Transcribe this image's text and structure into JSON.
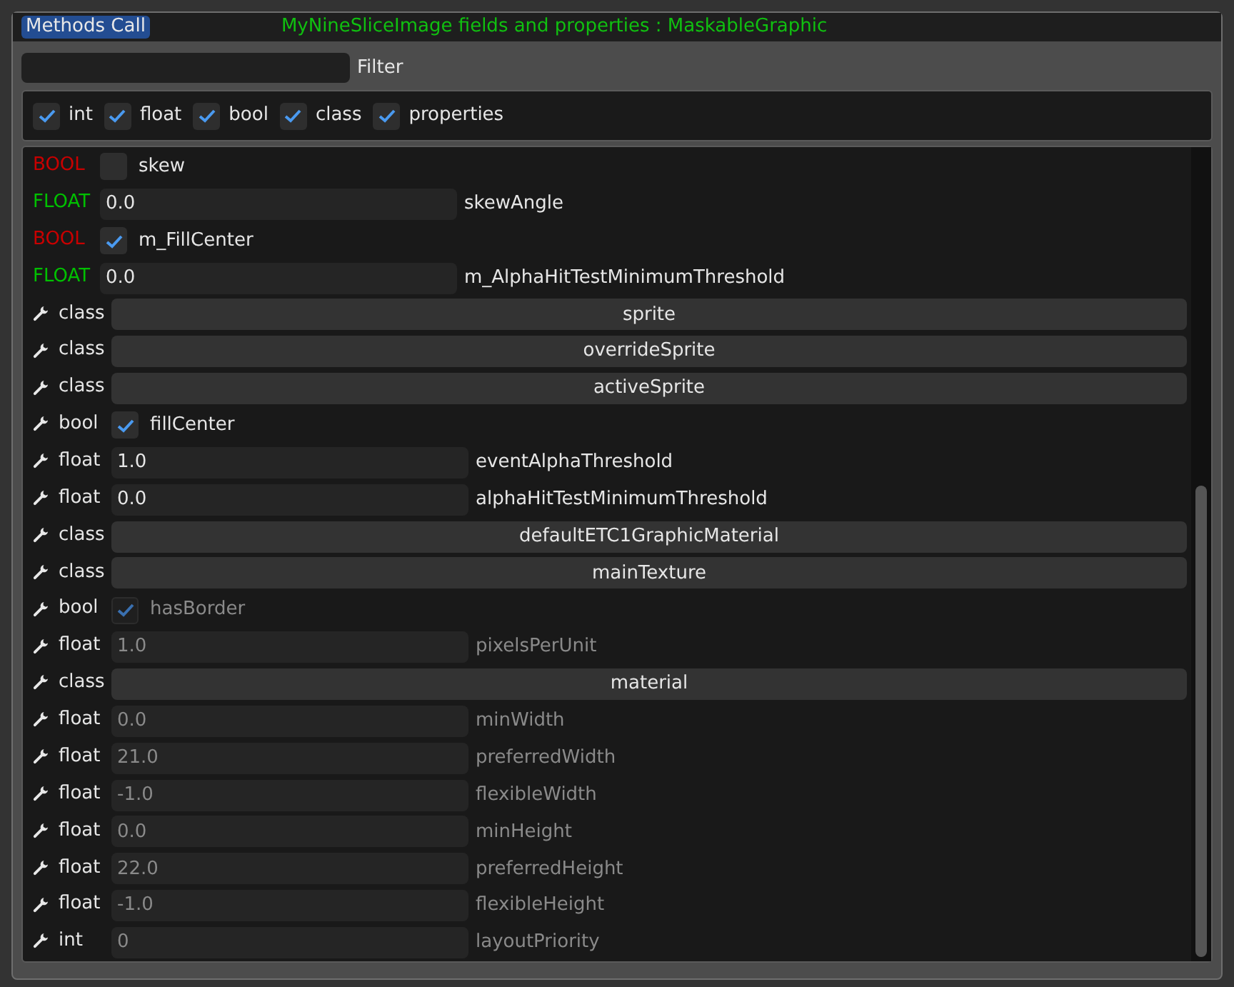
{
  "header": {
    "button": "Methods Call",
    "title": "MyNineSliceImage fields and properties : MaskableGraphic"
  },
  "filter": {
    "label": "Filter"
  },
  "type_filters": [
    {
      "label": "int",
      "checked": true
    },
    {
      "label": "float",
      "checked": true
    },
    {
      "label": "bool",
      "checked": true
    },
    {
      "label": "class",
      "checked": true
    },
    {
      "label": "properties",
      "checked": true
    }
  ],
  "rows": [
    {
      "property": false,
      "kind": "checkbox",
      "type": "BOOL",
      "color": "#c80000",
      "name": "skew",
      "checked": false,
      "disabled": false
    },
    {
      "property": false,
      "kind": "number",
      "type": "FLOAT",
      "color": "#00c000",
      "value": "0.0",
      "name": "skewAngle",
      "disabled": false
    },
    {
      "property": false,
      "kind": "checkbox",
      "type": "BOOL",
      "color": "#c80000",
      "name": "m_FillCenter",
      "checked": true,
      "disabled": false
    },
    {
      "property": false,
      "kind": "number",
      "type": "FLOAT",
      "color": "#00c000",
      "value": "0.0",
      "name": "m_AlphaHitTestMinimumThreshold",
      "disabled": false
    },
    {
      "property": true,
      "kind": "class",
      "type": "class",
      "name": "sprite"
    },
    {
      "property": true,
      "kind": "class",
      "type": "class",
      "name": "overrideSprite"
    },
    {
      "property": true,
      "kind": "class",
      "type": "class",
      "name": "activeSprite"
    },
    {
      "property": true,
      "kind": "checkbox",
      "type": "bool",
      "name": "fillCenter",
      "checked": true,
      "disabled": false
    },
    {
      "property": true,
      "kind": "number",
      "type": "float",
      "value": "1.0",
      "name": "eventAlphaThreshold",
      "disabled": false
    },
    {
      "property": true,
      "kind": "number",
      "type": "float",
      "value": "0.0",
      "name": "alphaHitTestMinimumThreshold",
      "disabled": false
    },
    {
      "property": true,
      "kind": "class",
      "type": "class",
      "name": "defaultETC1GraphicMaterial"
    },
    {
      "property": true,
      "kind": "class",
      "type": "class",
      "name": "mainTexture"
    },
    {
      "property": true,
      "kind": "checkbox",
      "type": "bool",
      "name": "hasBorder",
      "checked": true,
      "disabled": true
    },
    {
      "property": true,
      "kind": "number",
      "type": "float",
      "value": "1.0",
      "name": "pixelsPerUnit",
      "disabled": true
    },
    {
      "property": true,
      "kind": "class",
      "type": "class",
      "name": "material"
    },
    {
      "property": true,
      "kind": "number",
      "type": "float",
      "value": "0.0",
      "name": "minWidth",
      "disabled": true
    },
    {
      "property": true,
      "kind": "number",
      "type": "float",
      "value": "21.0",
      "name": "preferredWidth",
      "disabled": true
    },
    {
      "property": true,
      "kind": "number",
      "type": "float",
      "value": "-1.0",
      "name": "flexibleWidth",
      "disabled": true
    },
    {
      "property": true,
      "kind": "number",
      "type": "float",
      "value": "0.0",
      "name": "minHeight",
      "disabled": true
    },
    {
      "property": true,
      "kind": "number",
      "type": "float",
      "value": "22.0",
      "name": "preferredHeight",
      "disabled": true
    },
    {
      "property": true,
      "kind": "number",
      "type": "float",
      "value": "-1.0",
      "name": "flexibleHeight",
      "disabled": true
    },
    {
      "property": true,
      "kind": "number",
      "type": "int",
      "value": "0",
      "name": "layoutPriority",
      "disabled": true
    }
  ]
}
